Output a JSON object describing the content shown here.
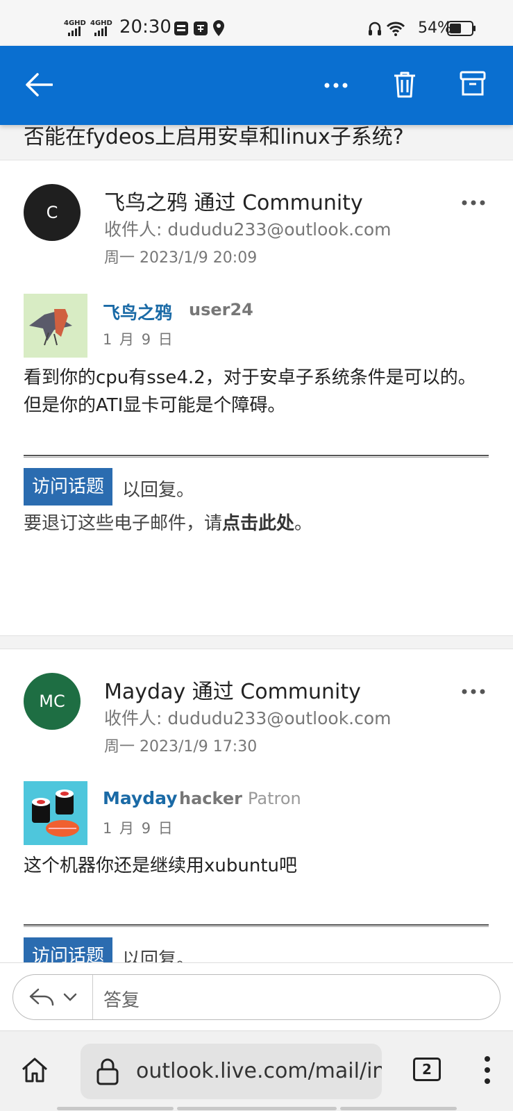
{
  "status_bar": {
    "signal_1": "4GHD",
    "signal_2": "4GHD",
    "time": "20:30",
    "battery": "54%"
  },
  "app_bar": {
    "icons": [
      "back-arrow-icon",
      "more-icon",
      "trash-icon",
      "archive-icon"
    ]
  },
  "subject": "否能在fydeos上启用安卓和linux子系统?",
  "messages": [
    {
      "avatar_initials": "C",
      "avatar_color": "#1f1f1f",
      "sender": "飞鸟之鸦 通过 Community",
      "recipient": "收件人: dududu233@outlook.com",
      "date": "周一 2023/1/9 20:09",
      "post_user": "飞鸟之鸦",
      "post_role": "user24",
      "post_tag": "",
      "post_date": "1 月 9 日",
      "body": "看到你的cpu有sse4.2，对于安卓子系统条件是可以的。但是你的ATI显卡可能是个障碍。",
      "visit_label": "访问话题",
      "visit_suffix": "以回复。",
      "unsub_prefix": "要退订这些电子邮件，请",
      "unsub_link": "点击此处",
      "unsub_suffix": "。"
    },
    {
      "avatar_initials": "MC",
      "avatar_color": "#1e6e43",
      "sender": "Mayday 通过 Community",
      "recipient": "收件人: dududu233@outlook.com",
      "date": "周一 2023/1/9 17:30",
      "post_user": "Mayday",
      "post_role": "hacker",
      "post_tag": "Patron",
      "post_date": "1 月 9 日",
      "body": "这个机器你还是继续用xubuntu吧",
      "visit_label": "访问话题",
      "visit_suffix": "以回复。"
    }
  ],
  "reply_bar": {
    "placeholder": "答复"
  },
  "browser_bar": {
    "url": "outlook.live.com/mail/in",
    "tab_count": "2"
  },
  "colors": {
    "accent": "#0a6fd0",
    "link": "#1a6aa6",
    "visit_button": "#2b6cb0"
  }
}
